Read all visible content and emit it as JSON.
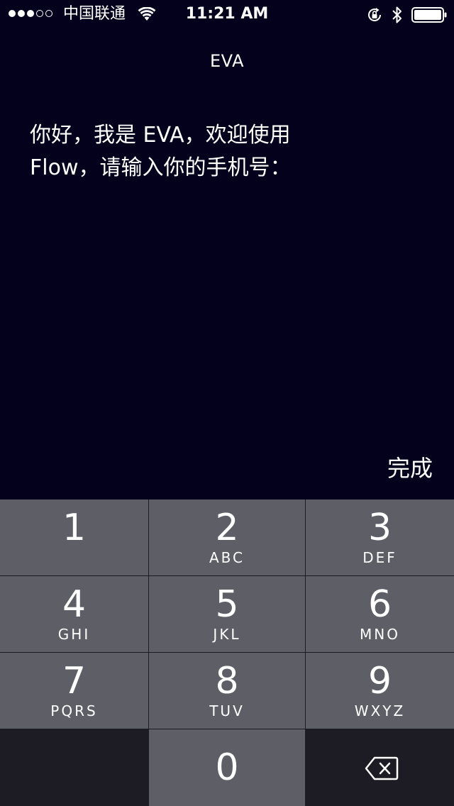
{
  "status_bar": {
    "carrier": "中国联通",
    "time": "11:21 AM",
    "signal_bars_filled": 3,
    "signal_bars_total": 5,
    "icons": [
      "signal-dots-icon",
      "wifi-icon",
      "rotation-lock-icon",
      "bluetooth-icon",
      "battery-icon"
    ],
    "battery_level": 1.0
  },
  "nav": {
    "title": "EVA"
  },
  "prompt": {
    "text": "你好，我是 EVA，欢迎使用\nFlow，请输入你的手机号："
  },
  "toolbar": {
    "done_label": "完成"
  },
  "keypad": {
    "keys": [
      {
        "digit": "1",
        "letters": ""
      },
      {
        "digit": "2",
        "letters": "ABC"
      },
      {
        "digit": "3",
        "letters": "DEF"
      },
      {
        "digit": "4",
        "letters": "GHI"
      },
      {
        "digit": "5",
        "letters": "JKL"
      },
      {
        "digit": "6",
        "letters": "MNO"
      },
      {
        "digit": "7",
        "letters": "PQRS"
      },
      {
        "digit": "8",
        "letters": "TUV"
      },
      {
        "digit": "9",
        "letters": "WXYZ"
      },
      {
        "digit": "0",
        "letters": ""
      }
    ],
    "delete_icon": "backspace-icon"
  },
  "colors": {
    "background": "#04011c",
    "key": "#5e5e66",
    "key_dark": "#1d1c24",
    "text": "#ffffff"
  }
}
